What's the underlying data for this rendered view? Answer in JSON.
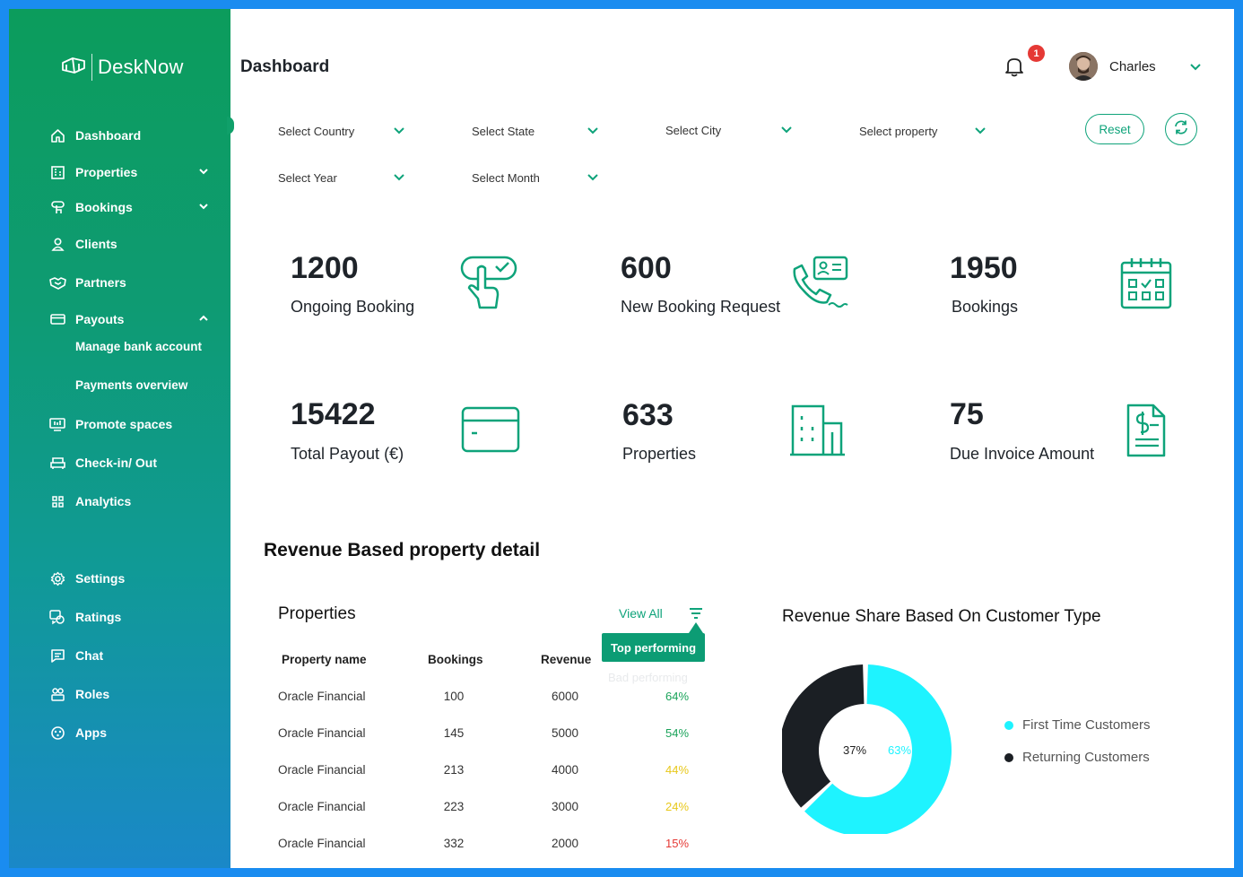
{
  "app": {
    "name": "DeskNow",
    "page_title": "Dashboard",
    "notifications_count": "1",
    "user_name": "Charles"
  },
  "sidebar": {
    "items": [
      {
        "label": "Dashboard",
        "icon": "home-icon"
      },
      {
        "label": "Properties",
        "icon": "building-icon"
      },
      {
        "label": "Bookings",
        "icon": "booking-icon"
      },
      {
        "label": "Clients",
        "icon": "user-icon"
      },
      {
        "label": "Partners",
        "icon": "handshake-icon"
      },
      {
        "label": "Payouts",
        "icon": "card-icon"
      },
      {
        "label": "Manage bank account"
      },
      {
        "label": "Payments overview"
      },
      {
        "label": "Promote spaces",
        "icon": "promote-icon"
      },
      {
        "label": "Check-in/ Out",
        "icon": "checkin-icon"
      },
      {
        "label": "Analytics",
        "icon": "analytics-icon"
      },
      {
        "label": "Settings",
        "icon": "gear-icon"
      },
      {
        "label": "Ratings",
        "icon": "ratings-icon"
      },
      {
        "label": "Chat",
        "icon": "chat-icon"
      },
      {
        "label": "Roles",
        "icon": "roles-icon"
      },
      {
        "label": "Apps",
        "icon": "apps-icon"
      }
    ]
  },
  "filters": {
    "country": "Select Country",
    "state": "Select State",
    "city": "Select City",
    "property": "Select property",
    "year": "Select Year",
    "month": "Select Month",
    "reset_label": "Reset"
  },
  "stats": [
    {
      "value": "1200",
      "label": "Ongoing Booking"
    },
    {
      "value": "600",
      "label": "New Booking Request"
    },
    {
      "value": "1950",
      "label": "Bookings"
    },
    {
      "value": "15422",
      "label": "Total Payout  (€)"
    },
    {
      "value": "633",
      "label": "Properties"
    },
    {
      "value": "75",
      "label": "Due Invoice Amount"
    }
  ],
  "revenue_section": {
    "title": "Revenue Based property detail",
    "properties_title": "Properties",
    "view_all": "View All",
    "tooltip": "Top performing",
    "ghost": "Bad performing",
    "columns": [
      "Property name",
      "Bookings",
      "Revenue"
    ],
    "rows": [
      {
        "name": "Oracle Financial",
        "bookings": "100",
        "revenue": "6000",
        "pct": "64%"
      },
      {
        "name": "Oracle Financial",
        "bookings": "145",
        "revenue": "5000",
        "pct": "54%"
      },
      {
        "name": "Oracle Financial",
        "bookings": "213",
        "revenue": "4000",
        "pct": "44%"
      },
      {
        "name": "Oracle Financial",
        "bookings": "223",
        "revenue": "3000",
        "pct": "24%"
      },
      {
        "name": "Oracle Financial",
        "bookings": "332",
        "revenue": "2000",
        "pct": "15%"
      }
    ],
    "pct_colors": [
      "#1aa35a",
      "#1aa35a",
      "#e8c81a",
      "#e8c81a",
      "#e53935"
    ]
  },
  "chart_data": {
    "type": "pie",
    "title": "Revenue Share Based On Customer Type",
    "series": [
      {
        "name": "First Time Customers",
        "value": 63,
        "label": "63%",
        "color": "#1ef3ff"
      },
      {
        "name": "Returning Customers",
        "value": 37,
        "label": "37%",
        "color": "#1b1f24"
      }
    ],
    "legend": "right"
  },
  "colors": {
    "accent": "#0ea37a",
    "badge": "#e53935"
  }
}
